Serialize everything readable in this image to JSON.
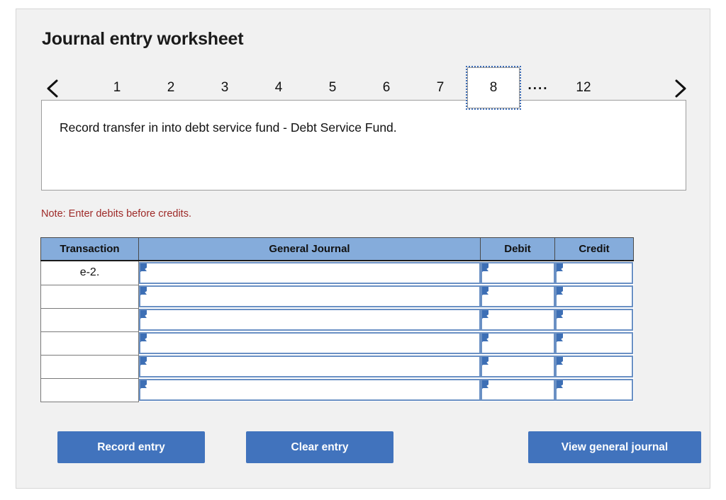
{
  "panel": {
    "title": "Journal entry worksheet"
  },
  "pager": {
    "prev_icon": "chevron-left-icon",
    "next_icon": "chevron-right-icon",
    "pages": [
      "1",
      "2",
      "3",
      "4",
      "5",
      "6",
      "7",
      "8"
    ],
    "selected_page": "8",
    "ellipsis": "....",
    "last_page": "12"
  },
  "instruction": {
    "text": "Record transfer in into debt service fund - Debt Service Fund."
  },
  "note": {
    "text": "Note: Enter debits before credits.",
    "color": "#9e2a28"
  },
  "table": {
    "headers": {
      "transaction": "Transaction",
      "general_journal": "General Journal",
      "debit": "Debit",
      "credit": "Credit"
    },
    "header_bg": "#85acdb",
    "input_border": "#6a90c4",
    "rows": [
      {
        "transaction": "e-2.",
        "general_journal": "",
        "debit": "",
        "credit": ""
      },
      {
        "transaction": "",
        "general_journal": "",
        "debit": "",
        "credit": ""
      },
      {
        "transaction": "",
        "general_journal": "",
        "debit": "",
        "credit": ""
      },
      {
        "transaction": "",
        "general_journal": "",
        "debit": "",
        "credit": ""
      },
      {
        "transaction": "",
        "general_journal": "",
        "debit": "",
        "credit": ""
      },
      {
        "transaction": "",
        "general_journal": "",
        "debit": "",
        "credit": ""
      }
    ]
  },
  "buttons": {
    "record_entry": "Record entry",
    "clear_entry": "Clear entry",
    "view_general_journal": "View general journal",
    "color": "#4173bd"
  }
}
